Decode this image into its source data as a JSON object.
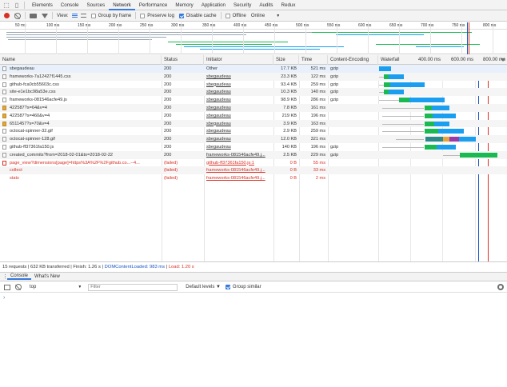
{
  "tabs": [
    "Elements",
    "Console",
    "Sources",
    "Network",
    "Performance",
    "Memory",
    "Application",
    "Security",
    "Audits",
    "Redux"
  ],
  "active_tab": "Network",
  "toolbar": {
    "view_label": "View:",
    "group_by_frame": "Group by frame",
    "preserve_log": "Preserve log",
    "disable_cache": "Disable cache",
    "offline": "Offline",
    "throttle": "Online",
    "throttle_arrow": "▼"
  },
  "overview_ticks": [
    "50 ms",
    "100 ms",
    "150 ms",
    "200 ms",
    "250 ms",
    "300 ms",
    "350 ms",
    "400 ms",
    "450 ms",
    "500 ms",
    "550 ms",
    "600 ms",
    "650 ms",
    "700 ms",
    "750 ms",
    "800 ms"
  ],
  "columns": {
    "name": "Name",
    "status": "Status",
    "initiator": "Initiator",
    "size": "Size",
    "time": "Time",
    "encoding": "Content-Encoding",
    "waterfall": "Waterfall"
  },
  "waterfall_ticks": [
    "400.00 ms",
    "600.00 ms",
    "800.00 ms"
  ],
  "rows": [
    {
      "name": "sbegaudeau",
      "status": "200",
      "initiator": "Other",
      "size": "17.7 KB",
      "time": "521 ms",
      "encoding": "gzip",
      "type": "doc",
      "failed": false
    },
    {
      "name": "frameworks-7a12427f1445.css",
      "status": "200",
      "initiator": "sbegaudeau",
      "size": "23.3 KB",
      "time": "122 ms",
      "encoding": "gzip",
      "type": "doc",
      "failed": false
    },
    {
      "name": "github-fca0cb55603c.css",
      "status": "200",
      "initiator": "sbegaudeau",
      "size": "93.4 KB",
      "time": "259 ms",
      "encoding": "gzip",
      "type": "doc",
      "failed": false
    },
    {
      "name": "site-e1e1bc98a53e.css",
      "status": "200",
      "initiator": "sbegaudeau",
      "size": "10.3 KB",
      "time": "140 ms",
      "encoding": "gzip",
      "type": "doc",
      "failed": false
    },
    {
      "name": "frameworks-081546acfe49.js",
      "status": "200",
      "initiator": "sbegaudeau",
      "size": "98.9 KB",
      "time": "286 ms",
      "encoding": "gzip",
      "type": "doc",
      "failed": false
    },
    {
      "name": "422587?s=64&v=4",
      "status": "200",
      "initiator": "sbegaudeau",
      "size": "7.8 KB",
      "time": "161 ms",
      "encoding": "",
      "type": "img",
      "failed": false
    },
    {
      "name": "422587?s=460&v=4",
      "status": "200",
      "initiator": "sbegaudeau",
      "size": "219 KB",
      "time": "196 ms",
      "encoding": "",
      "type": "img",
      "failed": false
    },
    {
      "name": "6511457?s=70&v=4",
      "status": "200",
      "initiator": "sbegaudeau",
      "size": "3.9 KB",
      "time": "163 ms",
      "encoding": "",
      "type": "img",
      "failed": false
    },
    {
      "name": "octocat-spinner-32.gif",
      "status": "200",
      "initiator": "sbegaudeau",
      "size": "2.9 KB",
      "time": "259 ms",
      "encoding": "",
      "type": "doc",
      "failed": false
    },
    {
      "name": "octocat-spinner-128.gif",
      "status": "200",
      "initiator": "sbegaudeau",
      "size": "12.0 KB",
      "time": "321 ms",
      "encoding": "",
      "type": "doc",
      "failed": false
    },
    {
      "name": "github-ff37361fa150.js",
      "status": "200",
      "initiator": "sbegaudeau",
      "size": "140 KB",
      "time": "196 ms",
      "encoding": "gzip",
      "type": "doc",
      "failed": false
    },
    {
      "name": "created_commits?from=2018-02-01&to=2018-02-22",
      "status": "200",
      "initiator": "frameworks-081546acfe49.j...",
      "size": "2.5 KB",
      "time": "229 ms",
      "encoding": "gzip",
      "type": "doc",
      "failed": false
    },
    {
      "name": "page_view?dimensions[page]=https%3A%2F%2Fgithub.co...--4...",
      "status": "(failed)",
      "initiator": "github-ff37361fa150.js:1",
      "size": "0 B",
      "time": "55 ms",
      "encoding": "",
      "type": "fail",
      "failed": true
    },
    {
      "name": "collect",
      "status": "(failed)",
      "initiator": "frameworks-081546acfe49.j...",
      "size": "0 B",
      "time": "33 ms",
      "encoding": "",
      "type": "none",
      "failed": true
    },
    {
      "name": "stats",
      "status": "(failed)",
      "initiator": "frameworks-081546acfe49.j...",
      "size": "0 B",
      "time": "2 ms",
      "encoding": "",
      "type": "none",
      "failed": true
    }
  ],
  "status_bar": {
    "summary": "15 requests | 632 KB transferred | Finish: 1.26 s |",
    "dom_content_loaded": "DOMContentLoaded: 983 ms",
    "sep": "|",
    "load": "Load: 1.20 s"
  },
  "drawer": {
    "tabs": [
      "Console",
      "What's New"
    ],
    "context": "top",
    "filter_placeholder": "Filter",
    "levels": "Default levels ▼",
    "group_similar": "Group similar",
    "prompt": "›"
  },
  "colors": {
    "accent": "#3879d9",
    "failed": "#d93025",
    "wf_green": "#1aba53",
    "wf_blue": "#1a9ef0",
    "dcl_line": "#1a55c0",
    "load_line": "#d93025"
  }
}
